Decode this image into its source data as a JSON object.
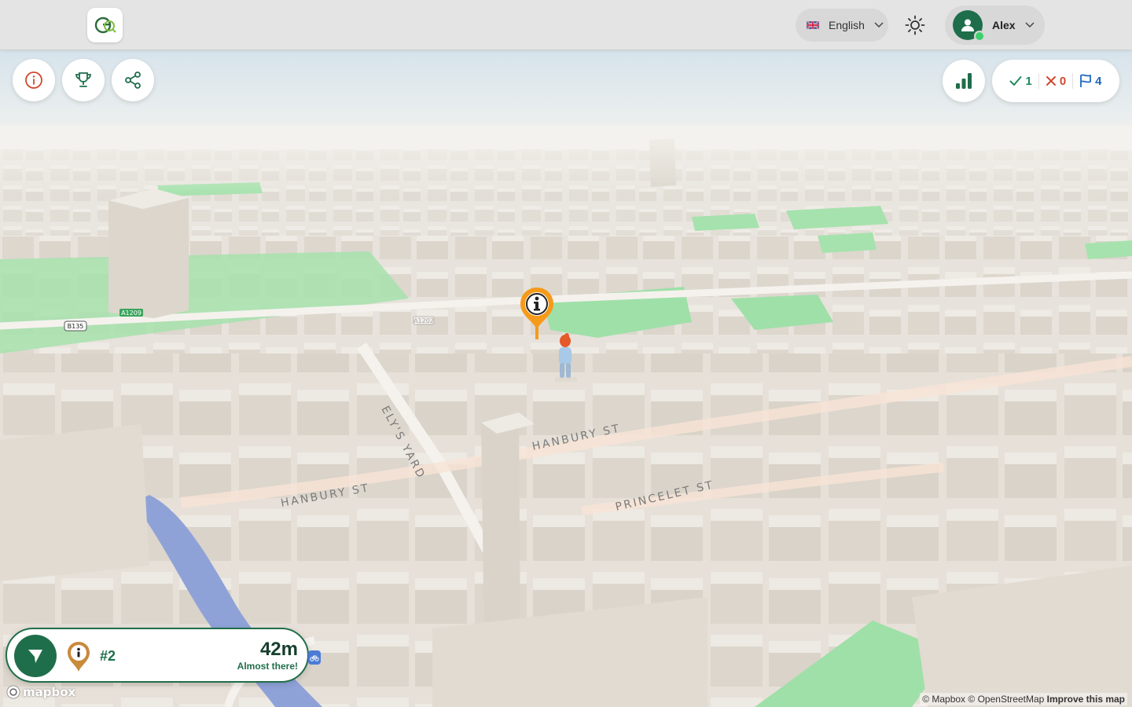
{
  "header": {
    "logo_text": "GQ",
    "language": {
      "label": "English",
      "flag": "uk-flag"
    },
    "user": {
      "name": "Alex",
      "status": "online"
    }
  },
  "left_controls": [
    "info-button",
    "trophy-button",
    "share-button"
  ],
  "stats": {
    "correct": "1",
    "wrong": "0",
    "flags": "4",
    "colors": {
      "correct": "#1f8a5b",
      "wrong": "#d0482e",
      "flags": "#1f66c2"
    }
  },
  "map": {
    "streets": [
      "HANBURY ST",
      "HANBURY ST",
      "ELY'S YARD",
      "PRINCELET ST"
    ],
    "road_shields": [
      "B135",
      "A1209",
      "A1202"
    ],
    "marker_icon": "info-pin-icon",
    "colors": {
      "building": "#e6e1da",
      "park": "#9fe0a8",
      "water": "#8fa2d8",
      "sky": "#d7e6ef"
    }
  },
  "navigation": {
    "rank": "#2",
    "distance": "42m",
    "status": "Almost there!"
  },
  "footer": {
    "mapbox_logo": "mapbox",
    "attribution": {
      "mapbox": "© Mapbox",
      "osm": "© OpenStreetMap",
      "improve": "Improve this map"
    }
  }
}
